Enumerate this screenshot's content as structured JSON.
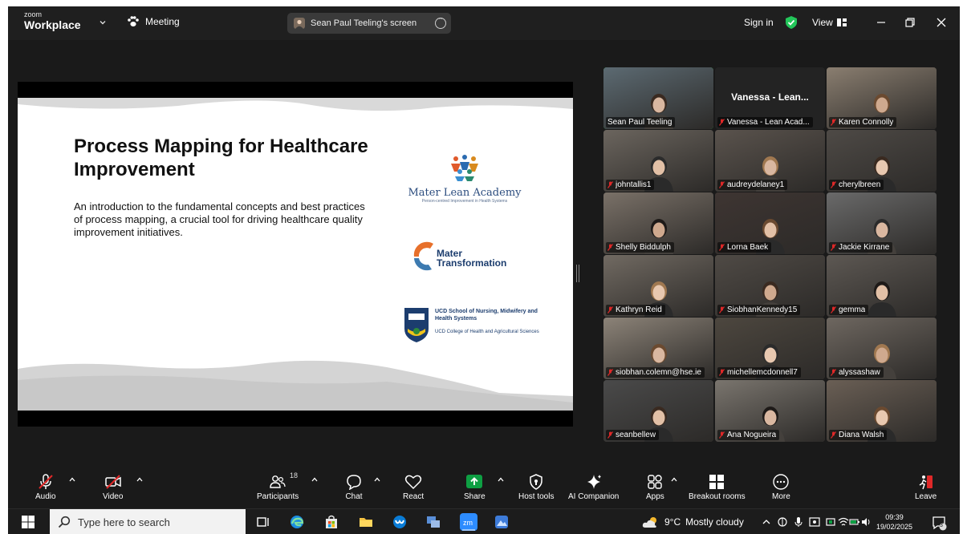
{
  "titlebar": {
    "brand_small": "zoom",
    "brand_large": "Workplace",
    "meeting_label": "Meeting",
    "share_label": "Sean Paul Teeling's screen",
    "sign_in": "Sign in",
    "view_label": "View"
  },
  "slide": {
    "title": "Process Mapping for Healthcare Improvement",
    "subtitle": "An introduction to the fundamental concepts and best practices of process mapping, a crucial tool for driving healthcare quality improvement initiatives.",
    "logo1_name": "Mater Lean Academy",
    "logo1_tag": "Person-centred Improvement in Health Systems",
    "logo2_line1": "Mater",
    "logo2_line2": "Transformation",
    "logo3_line1": "UCD School of Nursing, Midwifery and Health Systems",
    "logo3_line2": "UCD College of Health and Agricultural Sciences"
  },
  "gallery": {
    "featured_name": "Vanessa - Lean...",
    "participants": [
      {
        "name": "Sean Paul Teeling",
        "muted": false
      },
      {
        "name": "Vanessa - Lean Acad...",
        "muted": true
      },
      {
        "name": "Karen Connolly",
        "muted": true
      },
      {
        "name": "johntallis1",
        "muted": true
      },
      {
        "name": "audreydelaney1",
        "muted": true
      },
      {
        "name": "cherylbreen",
        "muted": true
      },
      {
        "name": "Shelly Biddulph",
        "muted": true
      },
      {
        "name": "Lorna Baek",
        "muted": true
      },
      {
        "name": "Jackie Kirrane",
        "muted": true
      },
      {
        "name": "Kathryn Reid",
        "muted": true
      },
      {
        "name": "SiobhanKennedy15",
        "muted": true
      },
      {
        "name": "gemma",
        "muted": true
      },
      {
        "name": "siobhan.colemn@hse.ie",
        "muted": true
      },
      {
        "name": "michellemcdonnell7",
        "muted": true
      },
      {
        "name": "alyssashaw",
        "muted": true
      },
      {
        "name": "seanbellew",
        "muted": true
      },
      {
        "name": "Ana Nogueira",
        "muted": true
      },
      {
        "name": "Diana Walsh",
        "muted": true
      }
    ]
  },
  "toolbar": {
    "audio": "Audio",
    "video": "Video",
    "participants": "Participants",
    "participants_count": "18",
    "chat": "Chat",
    "react": "React",
    "share": "Share",
    "host_tools": "Host tools",
    "ai_companion": "AI Companion",
    "apps": "Apps",
    "breakout_rooms": "Breakout rooms",
    "more": "More",
    "leave": "Leave"
  },
  "taskbar": {
    "search_placeholder": "Type here to search",
    "temperature": "9°C",
    "weather": "Mostly cloudy",
    "time": "09:39",
    "date": "19/02/2025",
    "notification_count": "3"
  },
  "colors": {
    "active_speaker": "#23d959",
    "muted_red": "#e02828",
    "share_green": "#0e9f43",
    "app_bg": "#1a1a1a"
  }
}
